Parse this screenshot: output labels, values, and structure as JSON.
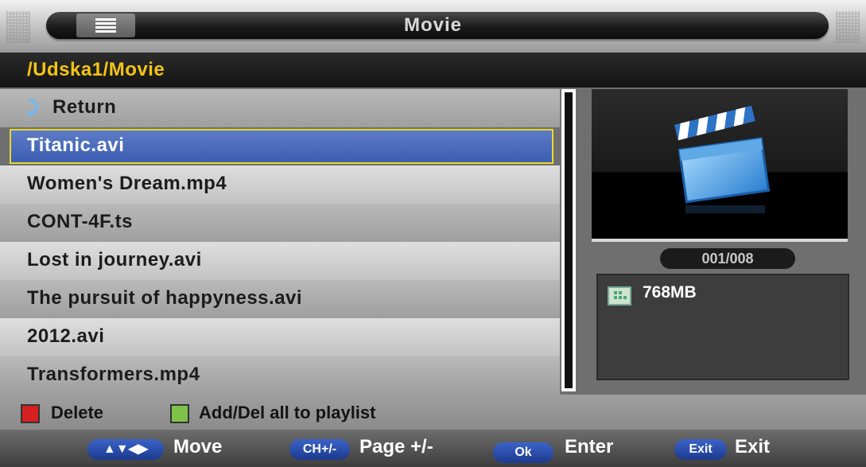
{
  "window": {
    "title": "Movie"
  },
  "path": "/Udska1/Movie",
  "list": {
    "return_label": "Return",
    "items": [
      "Titanic.avi",
      "Women's Dream.mp4",
      "CONT-4F.ts",
      "Lost in journey.avi",
      "The pursuit of happyness.avi",
      "2012.avi",
      "Transformers.mp4"
    ],
    "selected_index": 0
  },
  "preview": {
    "icon": "movie-clapperboard-icon",
    "counter": "001/008",
    "file_size": "768MB"
  },
  "legend": {
    "delete_label": "Delete",
    "playlist_label": "Add/Del all to playlist",
    "red": "#d42020",
    "green": "#7fc24a"
  },
  "footer": {
    "move_key": "▲▼◀▶",
    "move_label": "Move",
    "page_key": "CH+/-",
    "page_label": "Page +/-",
    "ok_key": "Ok",
    "ok_label": "Enter",
    "exit_key": "Exit",
    "exit_label": "Exit"
  },
  "colors": {
    "path_text": "#f3c416",
    "selection": "#4a6bbd",
    "selection_border": "#e9d92a",
    "key_button": "#2a4daa"
  }
}
